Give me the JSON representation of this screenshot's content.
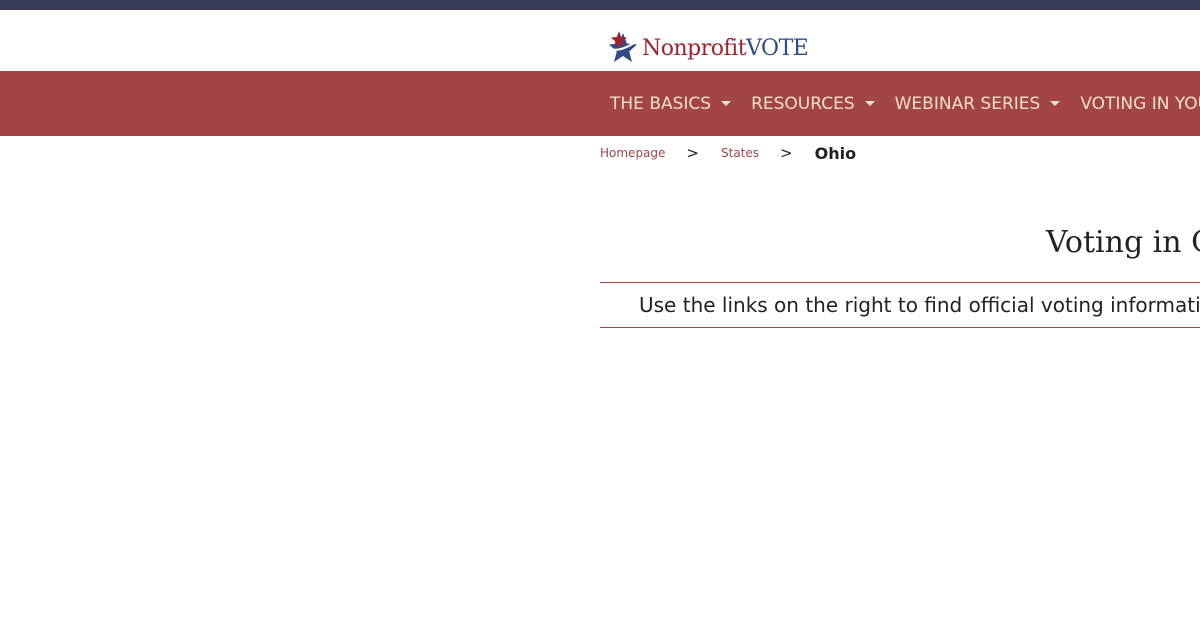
{
  "header": {
    "logo_text_part1": "Nonprofit",
    "logo_text_part2": "VOTE"
  },
  "nav": {
    "items": [
      {
        "label": "THE BASICS",
        "has_dropdown": true
      },
      {
        "label": "RESOURCES",
        "has_dropdown": true
      },
      {
        "label": "WEBINAR SERIES",
        "has_dropdown": true
      },
      {
        "label": "VOTING IN YOU",
        "has_dropdown": false
      }
    ]
  },
  "breadcrumb": {
    "items": [
      "Homepage",
      "States"
    ],
    "separator": ">",
    "current": "Ohio"
  },
  "main": {
    "title": "Voting in O",
    "intro": "Use the links on the right to find official voting informati"
  },
  "colors": {
    "top_strip": "#363a55",
    "nav_background": "#a34446",
    "nav_text": "#f3e1c3",
    "accent": "#a34446",
    "logo_red": "#9b2430",
    "logo_blue": "#2f4a86"
  },
  "icons": {
    "logo": "star-logo-icon",
    "dropdown": "caret-down-icon"
  }
}
